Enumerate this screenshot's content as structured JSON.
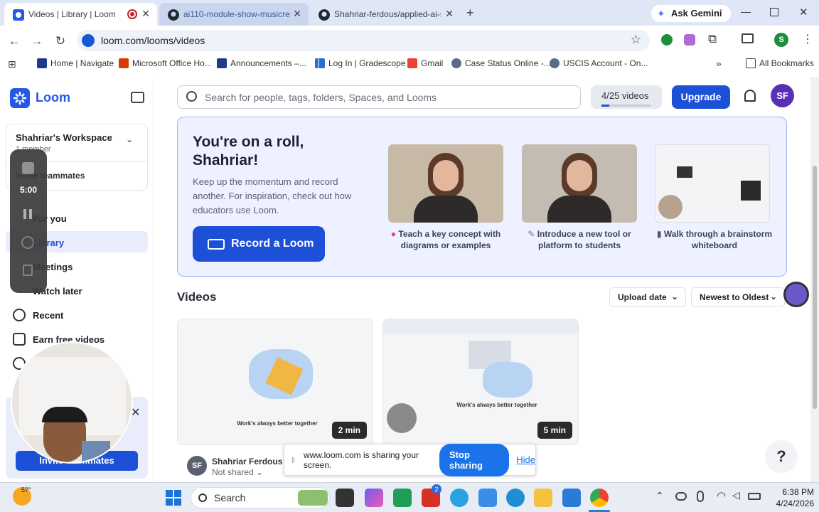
{
  "browser": {
    "tabs": [
      {
        "title": "Videos | Library | Loom",
        "active": true
      },
      {
        "title": "ai110-module-show-musicreco",
        "active": false
      },
      {
        "title": "Shahriar-ferdous/applied-ai-sy",
        "active": false
      }
    ],
    "gemini_label": "Ask Gemini",
    "url": "loom.com/looms/videos",
    "profile_initial": "S",
    "bookmarks": [
      "Home | Navigate",
      "Microsoft Office Ho...",
      "Announcements –...",
      "Log In | Gradescope",
      "Gmail",
      "Case Status Online -...",
      "USCIS Account - On..."
    ],
    "all_bookmarks": "All Bookmarks"
  },
  "sidebar": {
    "logo": "Loom",
    "workspace_name": "Shahriar's Workspace",
    "workspace_members": "1 member",
    "invite_partial": "Invite teammates",
    "items": [
      {
        "label": "For you"
      },
      {
        "label": "Library"
      },
      {
        "label": "Meetings"
      },
      {
        "label": "Watch later"
      },
      {
        "label": "Recent"
      },
      {
        "label": "Earn free videos"
      }
    ],
    "invite_button": "Invite teammates"
  },
  "recorder": {
    "timer": "5:00"
  },
  "header": {
    "search_placeholder": "Search for people, tags, folders, Spaces, and Looms",
    "video_count": "4/25 videos",
    "video_progress": 0.16,
    "upgrade": "Upgrade",
    "avatar": "SF"
  },
  "banner": {
    "title": "You're on a roll, Shahriar!",
    "body": "Keep up the momentum and record another. For inspiration, check out how educators use Loom.",
    "cta": "Record a Loom",
    "cards": [
      {
        "caption": "Teach a key concept with diagrams or examples"
      },
      {
        "caption": "Introduce a new tool or platform to students"
      },
      {
        "caption": "Walk through a brainstorm whiteboard"
      }
    ]
  },
  "videos": {
    "heading": "Videos",
    "sort_field": "Upload date",
    "sort_order": "Newest to Oldest",
    "items": [
      {
        "duration": "2 min",
        "thumb_text": "Work's always better together"
      },
      {
        "duration": "5 min",
        "thumb_text": "Work's always better together"
      }
    ],
    "owner_initials": "SF",
    "owner_name": "Shahriar Ferdous",
    "visibility": "Not shared"
  },
  "sharebar": {
    "message": "www.loom.com is sharing your screen.",
    "stop": "Stop sharing",
    "hide": "Hide"
  },
  "help": "?",
  "taskbar": {
    "weather": "57°",
    "search": "Search",
    "time": "6:38 PM",
    "date": "4/24/2026",
    "badge": "2"
  },
  "colors": {
    "loom_blue": "#1c50d6",
    "banner_bg": "#eef1ff",
    "purple_avatar": "#5b2fb5"
  }
}
